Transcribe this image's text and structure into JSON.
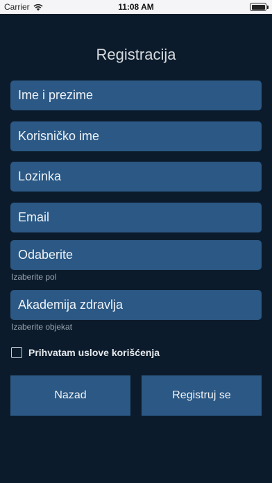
{
  "status_bar": {
    "carrier": "Carrier",
    "time": "11:08 AM"
  },
  "form": {
    "title": "Registracija",
    "fields": [
      {
        "placeholder": "Ime i prezime"
      },
      {
        "placeholder": "Korisničko ime"
      },
      {
        "placeholder": "Lozinka"
      },
      {
        "placeholder": "Email"
      }
    ],
    "gender_select": {
      "value": "Odaberite",
      "hint": "Izaberite pol"
    },
    "facility_select": {
      "value": "Akademija zdravlja",
      "hint": "Izaberite objekat"
    },
    "terms": {
      "label": "Prihvatam uslove korišćenja",
      "checked": false
    },
    "buttons": {
      "back": "Nazad",
      "register": "Registruj se"
    }
  },
  "colors": {
    "background": "#0c1b2b",
    "field": "#2b5884"
  }
}
